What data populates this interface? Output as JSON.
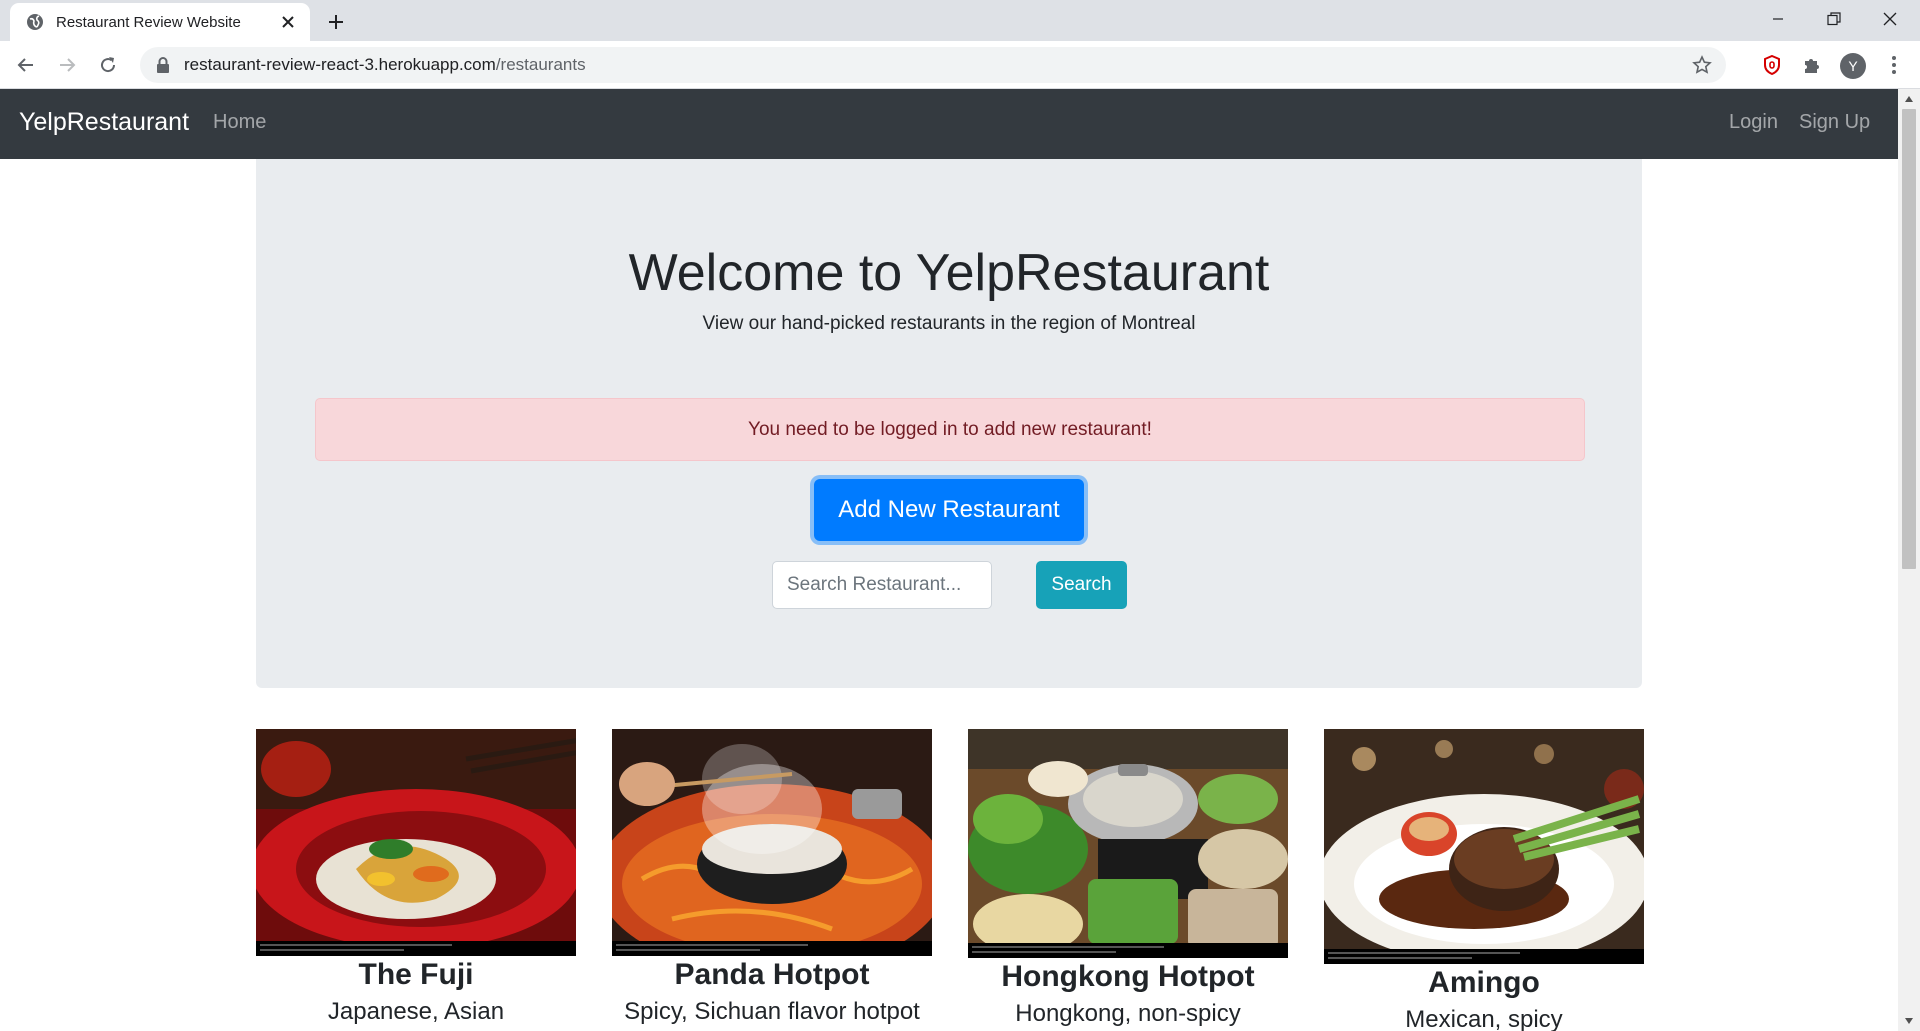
{
  "browser": {
    "tab_title": "Restaurant Review Website",
    "url_host": "restaurant-review-react-3.herokuapp.com",
    "url_path": "/restaurants",
    "profile_initial": "Y"
  },
  "nav": {
    "brand": "YelpRestaurant",
    "home": "Home",
    "login": "Login",
    "signup": "Sign Up"
  },
  "hero": {
    "title": "Welcome to YelpRestaurant",
    "subtitle": "View our hand-picked restaurants in the region of Montreal",
    "alert": "You need to be logged in to add new restaurant!",
    "add_button": "Add New Restaurant",
    "search_placeholder": "Search Restaurant...",
    "search_button": "Search"
  },
  "restaurants": [
    {
      "name": "The Fuji",
      "cuisine": "Japanese, Asian"
    },
    {
      "name": "Panda Hotpot",
      "cuisine": "Spicy, Sichuan flavor hotpot"
    },
    {
      "name": "Hongkong Hotpot",
      "cuisine": "Hongkong, non-spicy"
    },
    {
      "name": "Amingo",
      "cuisine": "Mexican, spicy"
    }
  ],
  "colors": {
    "navbar": "#343a40",
    "jumbotron": "#e9ecef",
    "primary": "#007bff",
    "info": "#17a2b8",
    "alert_bg": "#f8d7da",
    "alert_text": "#721c24"
  }
}
